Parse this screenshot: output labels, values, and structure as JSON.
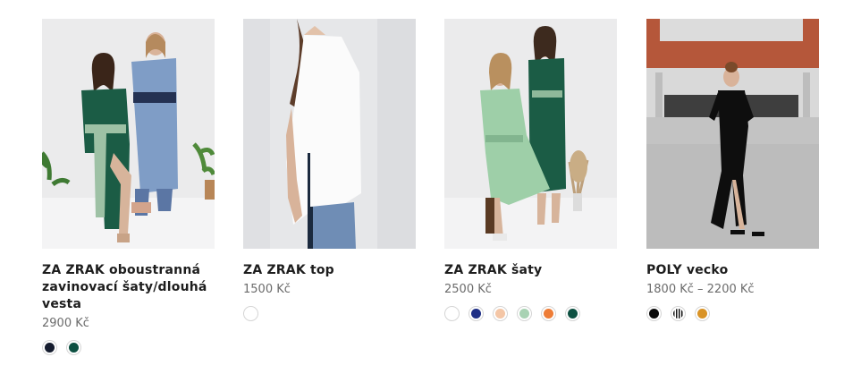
{
  "products": [
    {
      "name": "ZA ZRAK oboustranná zavinovací šaty/dlouhá vesta",
      "price": "2900 Kč",
      "swatches": [
        {
          "name": "navy",
          "color": "#151c2e"
        },
        {
          "name": "dark-green",
          "color": "#0d5041"
        }
      ]
    },
    {
      "name": "ZA ZRAK top",
      "price": "1500 Kč",
      "swatches": [
        {
          "name": "white",
          "color": "#ffffff"
        }
      ]
    },
    {
      "name": "ZA ZRAK šaty",
      "price": "2500 Kč",
      "swatches": [
        {
          "name": "white",
          "color": "#ffffff"
        },
        {
          "name": "royal-blue",
          "color": "#1f2f86"
        },
        {
          "name": "peach",
          "color": "#f4c6a6"
        },
        {
          "name": "mint",
          "color": "#a8d2b3"
        },
        {
          "name": "orange",
          "color": "#ee7d37"
        },
        {
          "name": "dark-green",
          "color": "#0d5041"
        }
      ]
    },
    {
      "name": "POLY vecko",
      "price": "1800 Kč – 2200 Kč",
      "swatches": [
        {
          "name": "black",
          "color": "#0a0a0a"
        },
        {
          "name": "black-white-stripes",
          "color": "#111111"
        },
        {
          "name": "mustard",
          "color": "#d99326"
        }
      ]
    }
  ]
}
